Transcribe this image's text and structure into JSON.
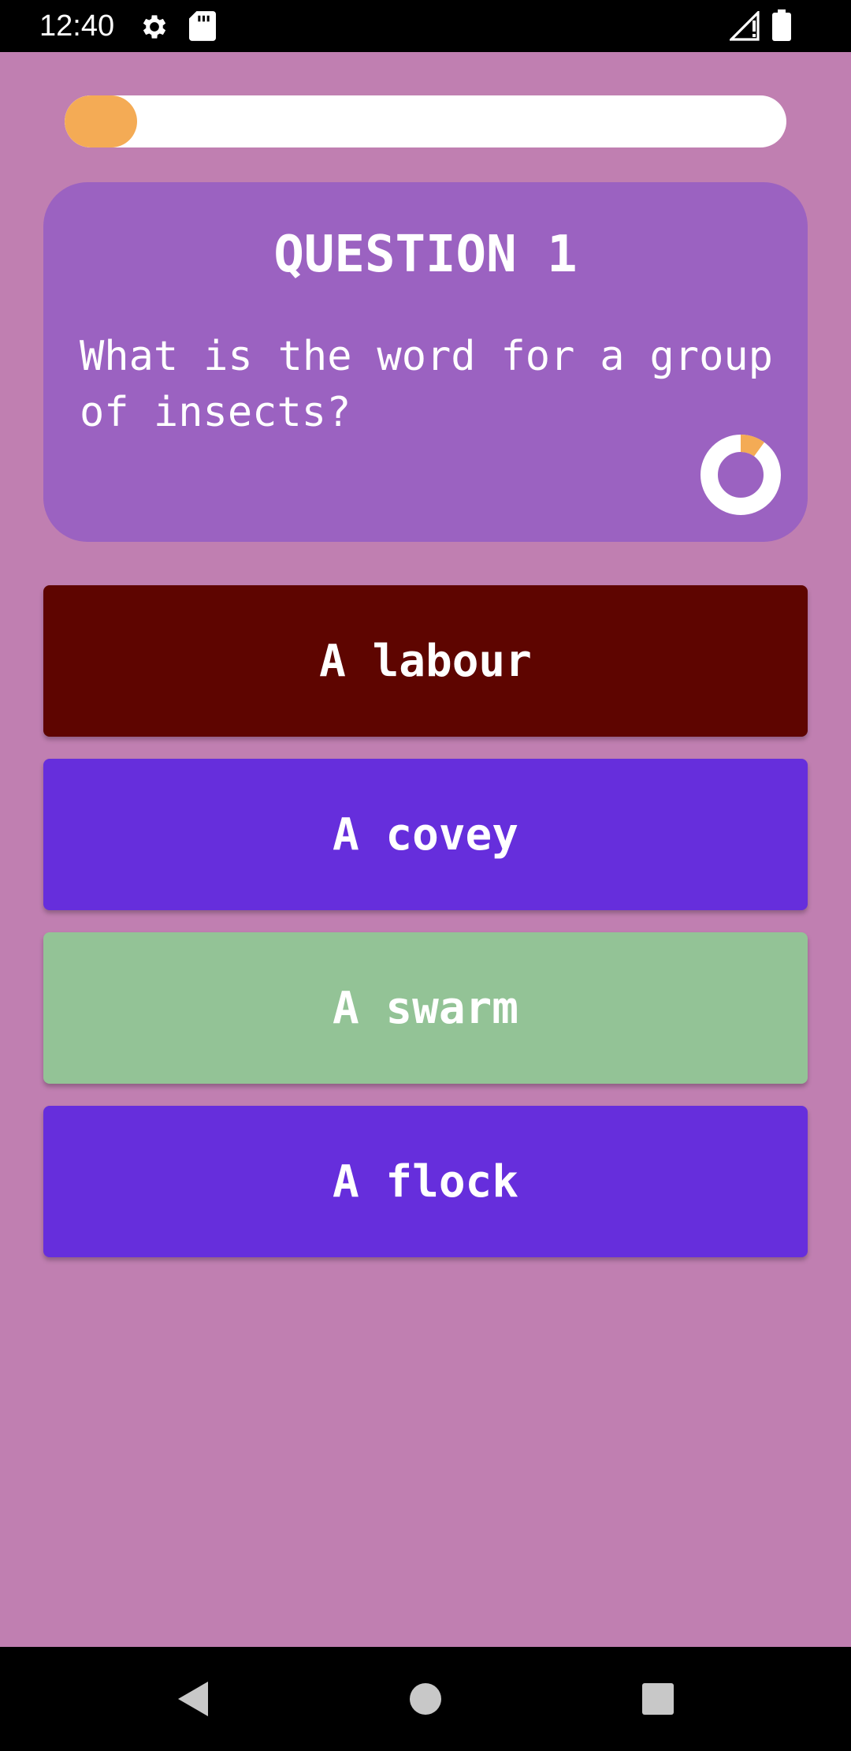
{
  "status_bar": {
    "time": "12:40",
    "icons": [
      "gear-icon",
      "sd-card-icon",
      "signal-icon",
      "battery-icon"
    ]
  },
  "progress": {
    "fraction": 0.1
  },
  "question": {
    "title": "QUESTION 1",
    "text": "What is the word for a group of insects?",
    "timer_fraction_elapsed": 0.1
  },
  "answers": [
    {
      "label": "A labour",
      "color": "#5e0500"
    },
    {
      "label": "A covey",
      "color": "#662edc"
    },
    {
      "label": "A swarm",
      "color": "#93c396"
    },
    {
      "label": "A flock",
      "color": "#662edc"
    }
  ],
  "colors": {
    "background": "#c07fb1",
    "card": "#9b62c1",
    "accent": "#f4ab55"
  },
  "nav_bar": {
    "icons": [
      "back-icon",
      "home-icon",
      "recents-icon"
    ]
  }
}
